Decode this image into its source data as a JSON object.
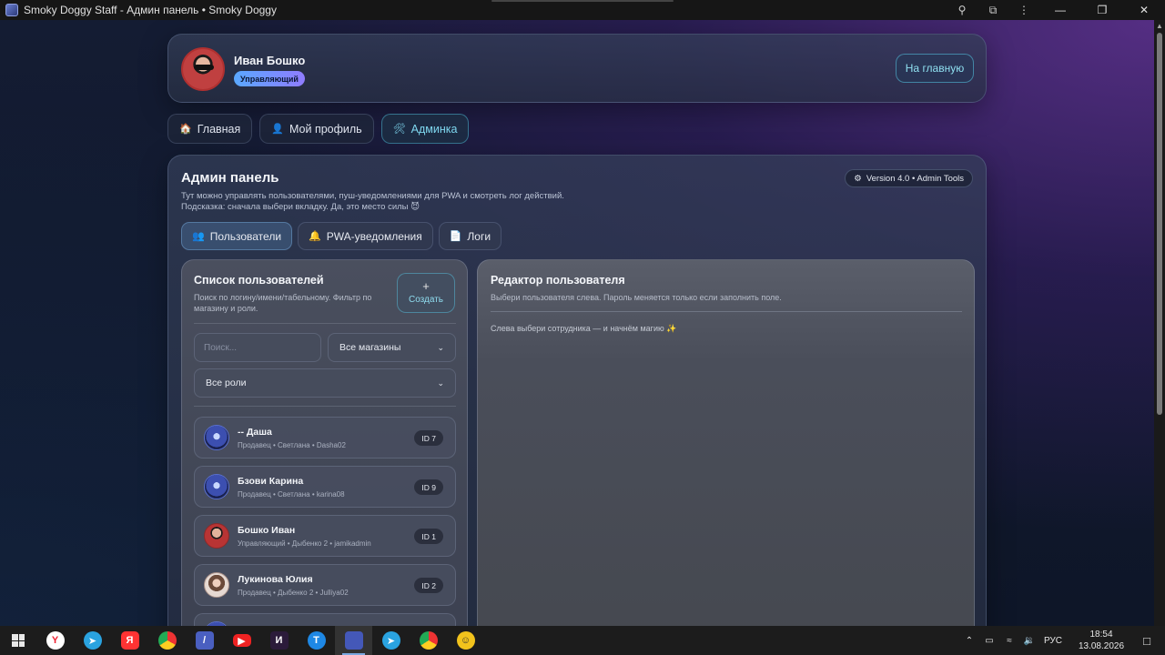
{
  "window": {
    "title": "Smoky Doggy Staff - Админ панель • Smoky Doggy"
  },
  "header": {
    "user_name": "Иван Бошко",
    "role": "Управляющий",
    "home_button": "На главную"
  },
  "nav": {
    "items": [
      {
        "icon": "🏠",
        "label": "Главная"
      },
      {
        "icon": "👤",
        "label": "Мой профиль"
      },
      {
        "icon": "🛠",
        "label": "Админка"
      }
    ]
  },
  "admin": {
    "title": "Админ панель",
    "desc_line1": "Тут можно управлять пользователями, пуш-уведомлениями для PWA и смотреть лог действий.",
    "desc_line2": "Подсказка: сначала выбери вкладку. Да, это место силы 😈",
    "version": "Version 4.0 • Admin Tools",
    "tabs": [
      {
        "icon": "👥",
        "label": "Пользователи"
      },
      {
        "icon": "🔔",
        "label": "PWA-уведомления"
      },
      {
        "icon": "📄",
        "label": "Логи"
      }
    ]
  },
  "users_panel": {
    "title": "Список пользователей",
    "desc": "Поиск по логину/имени/табельному. Фильтр по магазину и роли.",
    "create_label": "Создать",
    "search_placeholder": "Поиск...",
    "store_filter": "Все магазины",
    "role_filter": "Все роли",
    "users": [
      {
        "name": "-- Даша",
        "meta": "Продавец • Светлана • Dasha02",
        "id": "ID 7",
        "avatar": "blue"
      },
      {
        "name": "Бзови Карина",
        "meta": "Продавец • Светлана • karina08",
        "id": "ID 9",
        "avatar": "blue"
      },
      {
        "name": "Бошко Иван",
        "meta": "Управляющий • Дыбенко 2 • jamikadmin",
        "id": "ID 1",
        "avatar": "red"
      },
      {
        "name": "Лукинова Юлия",
        "meta": "Продавец • Дыбенко 2 • Julliya02",
        "id": "ID 2",
        "avatar": "girl"
      }
    ]
  },
  "editor": {
    "title": "Редактор пользователя",
    "desc": "Выбери пользователя слева. Пароль меняется только если заполнить поле.",
    "hint": "Слева выбери сотрудника — и начнём магию ✨"
  },
  "taskbar": {
    "language": "РУС",
    "time": "18:54",
    "date": "13.08.2026"
  },
  "colors": {
    "accent": "#7fd8f0",
    "role_badge_start": "#5aa8ff",
    "role_badge_end": "#8f7cff"
  }
}
